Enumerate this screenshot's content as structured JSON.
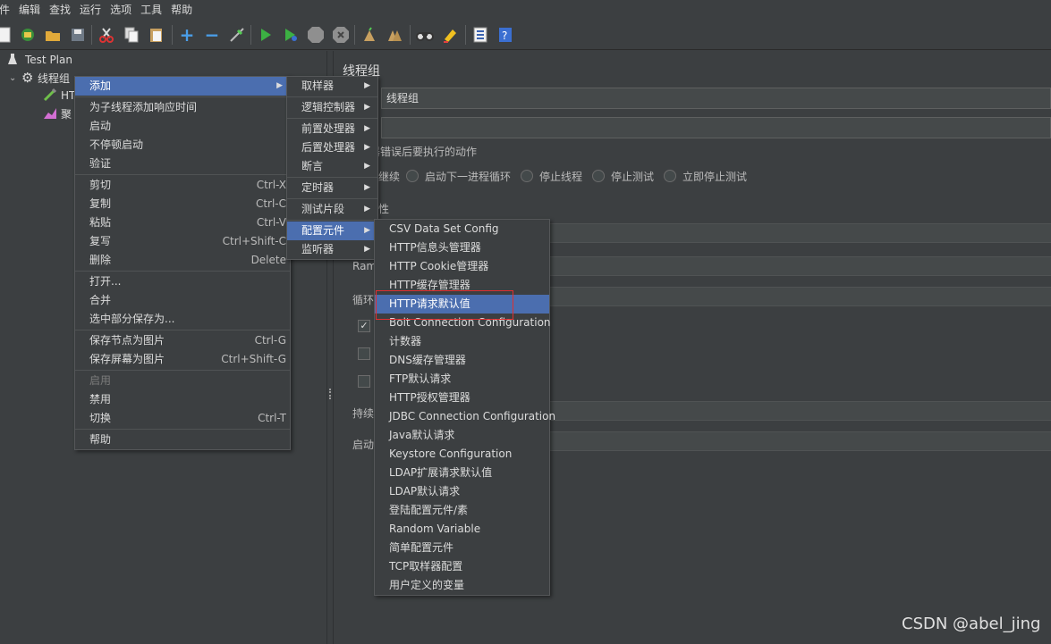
{
  "menubar": [
    "件",
    "编辑",
    "查找",
    "运行",
    "选项",
    "工具",
    "帮助"
  ],
  "toolbar_icons": [
    "new-file-icon",
    "templates-icon",
    "open-icon",
    "save-icon",
    "cut-icon",
    "copy-icon",
    "paste-icon",
    "expand-icon",
    "collapse-icon",
    "toggle-icon",
    "start-icon",
    "start-no-pause-icon",
    "stop-icon",
    "shutdown-icon",
    "clear-icon",
    "clear-all-icon",
    "search-icon",
    "reset-search-icon",
    "function-helper-icon",
    "help-icon"
  ],
  "tree": {
    "test_plan": "Test Plan",
    "thread_group": "线程组",
    "child1": "HT",
    "child2": "聚"
  },
  "right_pane": {
    "title": "线程组",
    "name_value": "线程组",
    "comment_value": "",
    "error_action_label": "器错误后要执行的动作",
    "radio_continue": "继续",
    "radio_next_loop": "启动下一进程循环",
    "radio_stop_thread": "停止线程",
    "radio_stop_test": "停止测试",
    "radio_stop_now": "立即停止测试",
    "props_label": "性",
    "ramp_label": "Ram",
    "loop_label": "循环",
    "duration_label": "持续",
    "delay_label": "启动"
  },
  "context_menu": {
    "items": [
      {
        "label": "添加",
        "shortcut": "",
        "submenu": true,
        "selected": true
      },
      {
        "sep": true
      },
      {
        "label": "为子线程添加响应时间",
        "shortcut": ""
      },
      {
        "label": "启动",
        "shortcut": ""
      },
      {
        "label": "不停顿启动",
        "shortcut": ""
      },
      {
        "label": "验证",
        "shortcut": ""
      },
      {
        "sep": true
      },
      {
        "label": "剪切",
        "shortcut": "Ctrl-X"
      },
      {
        "label": "复制",
        "shortcut": "Ctrl-C"
      },
      {
        "label": "粘贴",
        "shortcut": "Ctrl-V"
      },
      {
        "label": "复写",
        "shortcut": "Ctrl+Shift-C"
      },
      {
        "label": "删除",
        "shortcut": "Delete"
      },
      {
        "sep": true
      },
      {
        "label": "打开...",
        "shortcut": ""
      },
      {
        "label": "合并",
        "shortcut": ""
      },
      {
        "label": "选中部分保存为...",
        "shortcut": ""
      },
      {
        "sep": true
      },
      {
        "label": "保存节点为图片",
        "shortcut": "Ctrl-G"
      },
      {
        "label": "保存屏幕为图片",
        "shortcut": "Ctrl+Shift-G"
      },
      {
        "sep": true
      },
      {
        "label": "启用",
        "shortcut": "",
        "disabled": true
      },
      {
        "label": "禁用",
        "shortcut": ""
      },
      {
        "label": "切换",
        "shortcut": "Ctrl-T"
      },
      {
        "sep": true
      },
      {
        "label": "帮助",
        "shortcut": ""
      }
    ]
  },
  "add_submenu": {
    "items": [
      {
        "label": "取样器",
        "submenu": true
      },
      {
        "sep": true
      },
      {
        "label": "逻辑控制器",
        "submenu": true
      },
      {
        "sep": true
      },
      {
        "label": "前置处理器",
        "submenu": true
      },
      {
        "label": "后置处理器",
        "submenu": true
      },
      {
        "label": "断言",
        "submenu": true
      },
      {
        "sep": true
      },
      {
        "label": "定时器",
        "submenu": true
      },
      {
        "sep": true
      },
      {
        "label": "测试片段",
        "submenu": true
      },
      {
        "sep": true
      },
      {
        "label": "配置元件",
        "submenu": true,
        "selected": true
      },
      {
        "label": "监听器",
        "submenu": true
      }
    ]
  },
  "config_submenu": {
    "items": [
      {
        "label": "CSV Data Set Config"
      },
      {
        "label": "HTTP信息头管理器"
      },
      {
        "label": "HTTP Cookie管理器"
      },
      {
        "label": "HTTP缓存管理器"
      },
      {
        "label": "HTTP请求默认值",
        "selected": true
      },
      {
        "label": "Bolt Connection Configuration"
      },
      {
        "label": "计数器"
      },
      {
        "label": "DNS缓存管理器"
      },
      {
        "label": "FTP默认请求"
      },
      {
        "label": "HTTP授权管理器"
      },
      {
        "label": "JDBC Connection Configuration"
      },
      {
        "label": "Java默认请求"
      },
      {
        "label": "Keystore Configuration"
      },
      {
        "label": "LDAP扩展请求默认值"
      },
      {
        "label": "LDAP默认请求"
      },
      {
        "label": "登陆配置元件/素"
      },
      {
        "label": "Random Variable"
      },
      {
        "label": "简单配置元件"
      },
      {
        "label": "TCP取样器配置"
      },
      {
        "label": "用户定义的变量"
      }
    ]
  },
  "watermark": "CSDN @abel_jing"
}
